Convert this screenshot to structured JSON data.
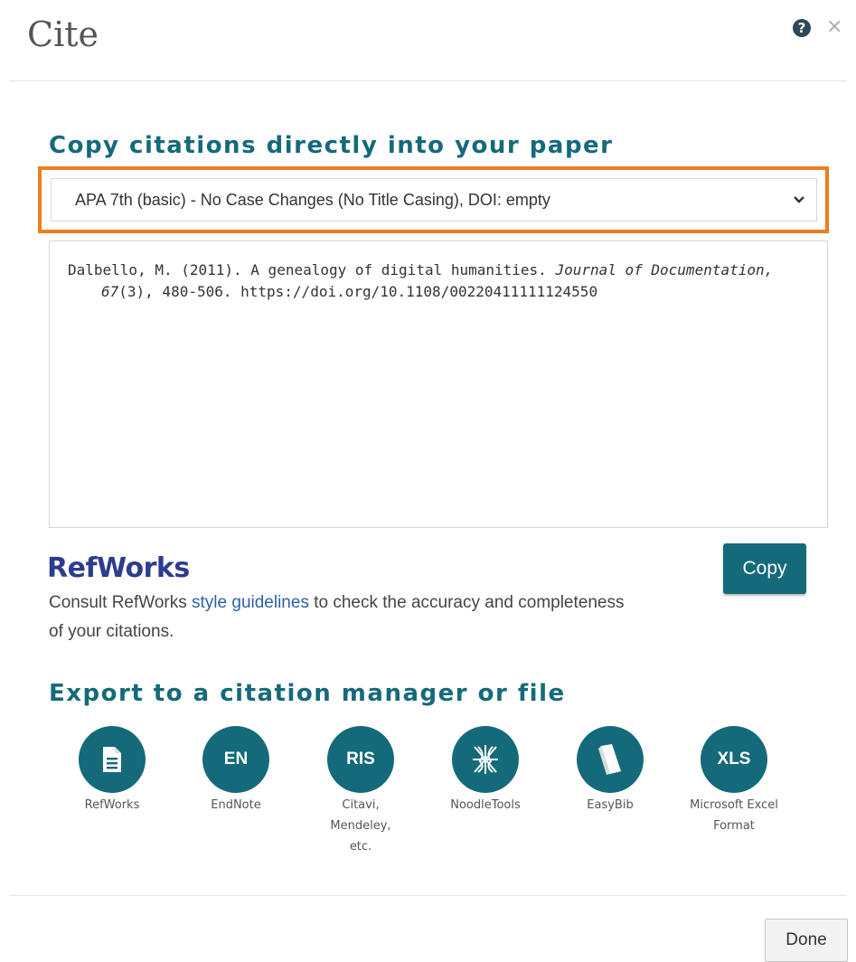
{
  "dialog": {
    "title": "Cite",
    "help_glyph": "?",
    "close_glyph": "×"
  },
  "copy_section": {
    "heading": "Copy citations directly into your paper",
    "style_select": {
      "selected": "APA 7th (basic) - No Case Changes (No Title Casing), DOI: empty",
      "highlight_color": "#ee7d21"
    },
    "citation": {
      "part1": "Dalbello, M. (2011). A genealogy of digital humanities. ",
      "journal": "Journal of Documentation,",
      "part2": " ",
      "volume": "67",
      "part3": "(3), 480-506. https://doi.org/10.1108/00220411111124550"
    },
    "copy_label": "Copy"
  },
  "refworks": {
    "title": "RefWorks",
    "note_before": "Consult RefWorks ",
    "note_link": "style guidelines",
    "note_after": " to check the accuracy and completeness of your citations."
  },
  "export": {
    "heading": "Export to a citation manager or file",
    "items": [
      {
        "icon": "document-icon",
        "glyph": "",
        "label": "RefWorks"
      },
      {
        "icon": "endnote-icon",
        "glyph": "EN",
        "label": "EndNote"
      },
      {
        "icon": "ris-icon",
        "glyph": "RIS",
        "label": "Citavi, Mendeley, etc."
      },
      {
        "icon": "noodletools-icon",
        "glyph": "",
        "label": "NoodleTools"
      },
      {
        "icon": "easybib-icon",
        "glyph": "",
        "label": "EasyBib"
      },
      {
        "icon": "xls-icon",
        "glyph": "XLS",
        "label": "Microsoft Excel Format"
      }
    ]
  },
  "footer": {
    "done_label": "Done"
  },
  "colors": {
    "accent": "#156a7a",
    "refworks_brand": "#2d3c8e",
    "link": "#2d5fa8"
  }
}
